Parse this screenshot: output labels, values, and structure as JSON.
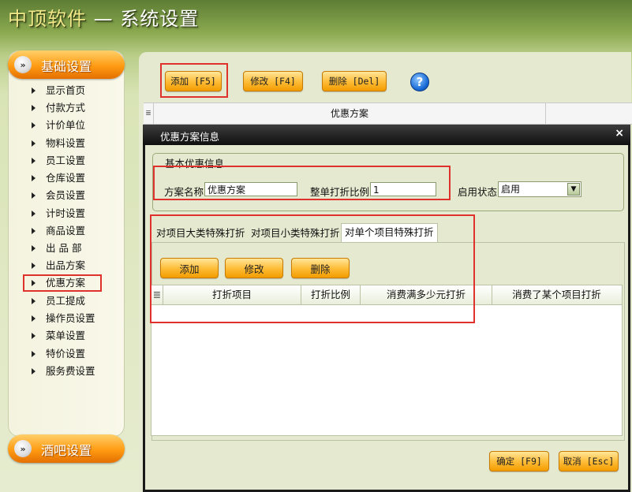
{
  "app": {
    "brand": "中顶软件",
    "separator": " — ",
    "title": "系统设置"
  },
  "sidebar": {
    "header_top": "基础设置",
    "header_bottom": "酒吧设置",
    "items": [
      {
        "label": "显示首页"
      },
      {
        "label": "付款方式"
      },
      {
        "label": "计价单位"
      },
      {
        "label": "物料设置"
      },
      {
        "label": "员工设置"
      },
      {
        "label": "仓库设置"
      },
      {
        "label": "会员设置"
      },
      {
        "label": "计时设置"
      },
      {
        "label": "商品设置"
      },
      {
        "label": "出 品 部"
      },
      {
        "label": "出品方案"
      },
      {
        "label": "优惠方案",
        "active": true
      },
      {
        "label": "员工提成"
      },
      {
        "label": "操作员设置"
      },
      {
        "label": "菜单设置"
      },
      {
        "label": "特价设置"
      },
      {
        "label": "服务费设置"
      }
    ]
  },
  "toolbar": {
    "add": "添加 [F5]",
    "edit": "修改 [F4]",
    "delete": "删除 [Del]",
    "help": "?"
  },
  "grid": {
    "column": "优惠方案"
  },
  "dialog": {
    "title": "优惠方案信息",
    "close": "×",
    "group_label": "基本优惠信息",
    "plan_name_label": "方案名称",
    "plan_name_value": "优惠方案",
    "ratio_label": "整单打折比例",
    "ratio_value": "1",
    "status_label": "启用状态",
    "status_value": "启用",
    "tabs": [
      "对项目大类特殊打折",
      "对项目小类特殊打折",
      "对单个项目特殊打折"
    ],
    "active_tab": 2,
    "sub_buttons": {
      "add": "添加",
      "edit": "修改",
      "delete": "删除"
    },
    "sub_columns": [
      "打折项目",
      "打折比例",
      "消费满多少元打折",
      "消费了某个项目打折"
    ],
    "ok": "确定 [F9]",
    "cancel": "取消 [Esc]"
  },
  "colors": {
    "accent": "#ff9b12",
    "highlight": "#e0322c",
    "panel": "#e4e9cf"
  }
}
